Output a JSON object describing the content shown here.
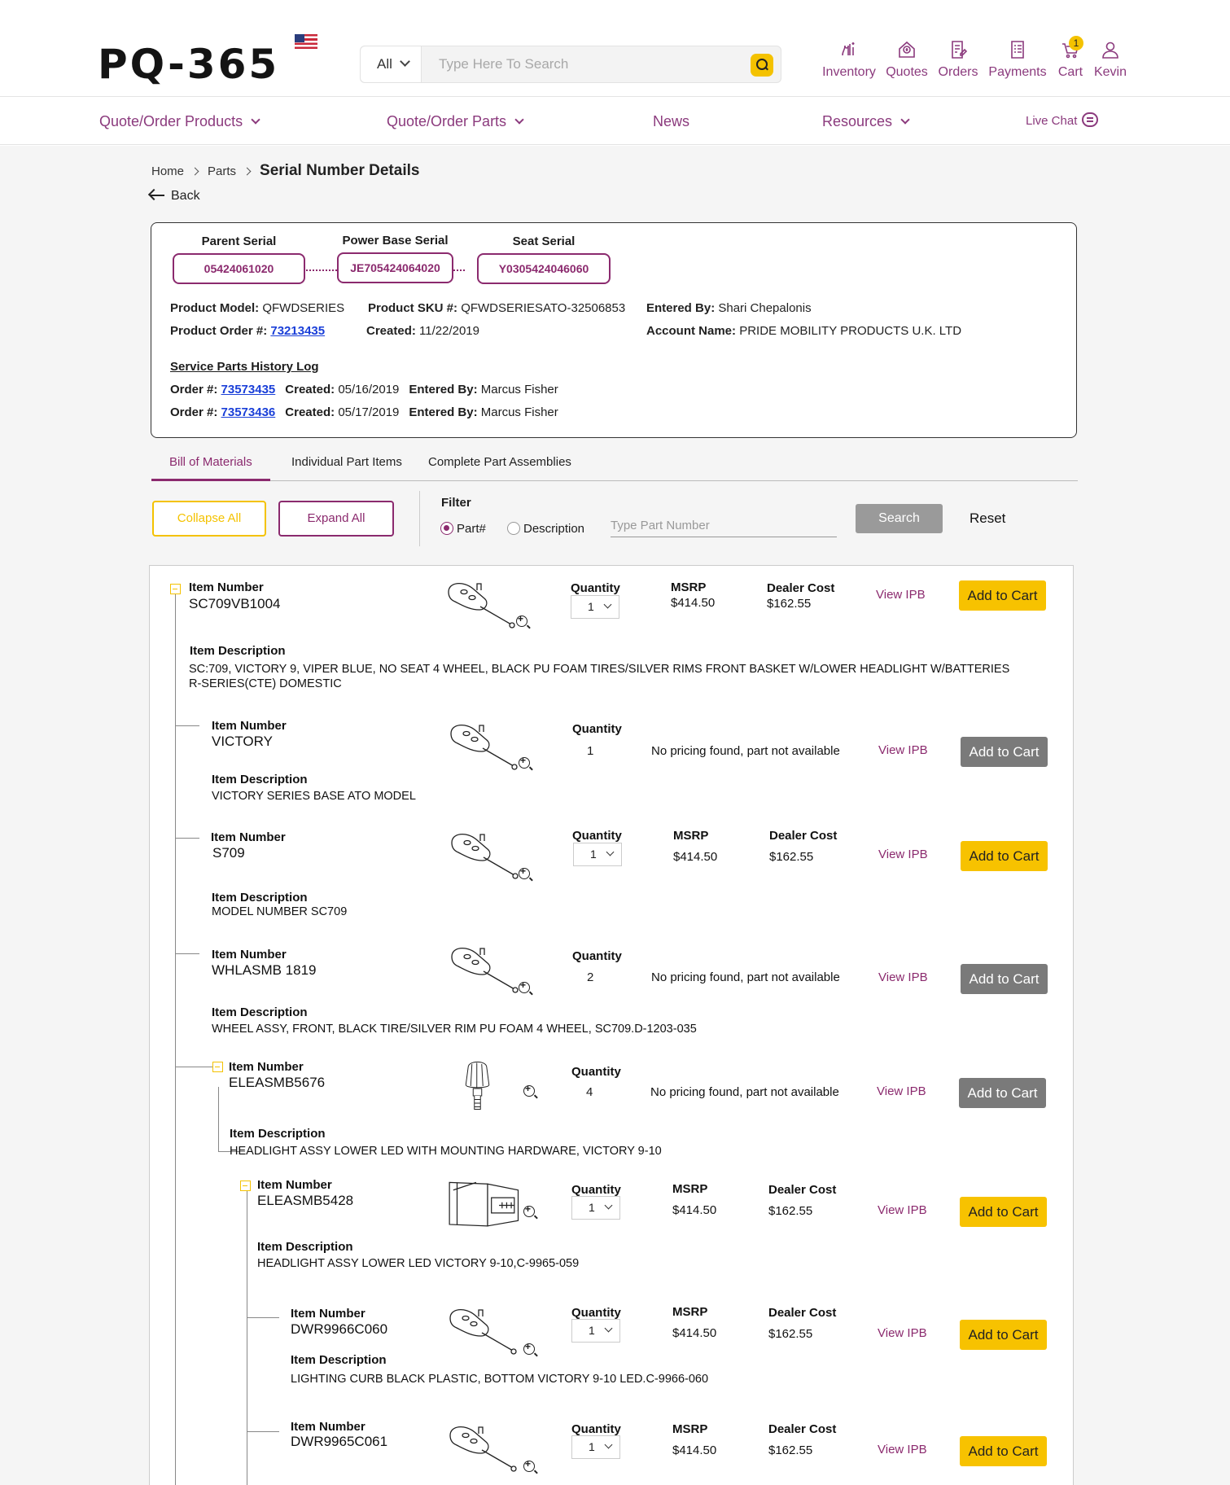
{
  "header": {
    "logo": "PQ-365",
    "search": {
      "category": "All",
      "placeholder": "Type Here To Search"
    },
    "nav": [
      {
        "label": "Inventory",
        "icon": "inventory-icon"
      },
      {
        "label": "Quotes",
        "icon": "quotes-icon"
      },
      {
        "label": "Orders",
        "icon": "orders-icon"
      },
      {
        "label": "Payments",
        "icon": "payments-icon"
      },
      {
        "label": "Cart",
        "icon": "cart-icon",
        "badge": "1"
      },
      {
        "label": "Kevin",
        "icon": "user-icon"
      }
    ]
  },
  "mainnav": {
    "items": [
      "Quote/Order Products",
      "Quote/Order Parts",
      "News",
      "Resources"
    ],
    "live_chat": "Live Chat"
  },
  "breadcrumb": {
    "home": "Home",
    "parts": "Parts",
    "current": "Serial Number Details"
  },
  "back": "Back",
  "serials": {
    "parent_label": "Parent Serial",
    "parent_value": "05424061020",
    "power_label": "Power Base Serial",
    "power_value": "JE705424064020",
    "seat_label": "Seat Serial",
    "seat_value": "Y0305424046060"
  },
  "details": {
    "model_label": "Product Model:",
    "model_value": "QFWDSERIES",
    "order_label": "Product Order #:",
    "order_value": "73213435",
    "sku_label": "Product SKU #:",
    "sku_value": "QFWDSERIESATO-32506853",
    "created_label": "Created:",
    "created_value": "11/22/2019",
    "entered_label": "Entered By:",
    "entered_value": "Shari Chepalonis",
    "account_label": "Account Name:",
    "account_value": "PRIDE MOBILITY PRODUCTS U.K. LTD"
  },
  "history": {
    "title": "Service Parts History Log",
    "order_label": "Order #:",
    "created_label": "Created:",
    "entered_label": "Entered By:",
    "rows": [
      {
        "order": "73573435",
        "created": "05/16/2019",
        "entered": "Marcus Fisher"
      },
      {
        "order": "73573436",
        "created": "05/17/2019",
        "entered": "Marcus Fisher"
      }
    ]
  },
  "tabs": [
    "Bill of Materials",
    "Individual Part Items",
    "Complete Part Assemblies"
  ],
  "controls": {
    "collapse": "Collapse All",
    "expand": "Expand All",
    "filter": "Filter",
    "radio_part": "Part#",
    "radio_desc": "Description",
    "input_placeholder": "Type Part Number",
    "search": "Search",
    "reset": "Reset"
  },
  "labels": {
    "item_number": "Item Number",
    "item_description": "Item Description",
    "quantity": "Quantity",
    "msrp": "MSRP",
    "dealer_cost": "Dealer Cost",
    "view_ipb": "View IPB",
    "add_to_cart": "Add to Cart",
    "no_pricing": "No pricing found, part not available"
  },
  "items": [
    {
      "number": "SC709VB1004",
      "desc": "SC:709, VICTORY 9, VIPER BLUE, NO SEAT 4 WHEEL, BLACK PU FOAM TIRES/SILVER RIMS FRONT BASKET W/LOWER HEADLIGHT W/BATTERIES R-SERIES(CTE) DOMESTIC",
      "qty": "1",
      "msrp": "$414.50",
      "dealer": "$162.55",
      "available": true
    },
    {
      "number": "VICTORY",
      "desc": "VICTORY SERIES BASE ATO MODEL",
      "qty": "1",
      "available": false
    },
    {
      "number": "S709",
      "desc": "MODEL NUMBER SC709",
      "qty": "1",
      "msrp": "$414.50",
      "dealer": "$162.55",
      "available": true
    },
    {
      "number": "WHLASMB 1819",
      "desc": "WHEEL ASSY, FRONT, BLACK TIRE/SILVER RIM PU FOAM 4 WHEEL, SC709.D-1203-035",
      "qty": "2",
      "available": false
    },
    {
      "number": "ELEASMB5676",
      "desc": "HEADLIGHT ASSY LOWER LED WITH MOUNTING HARDWARE, VICTORY 9-10",
      "qty": "4",
      "available": false
    },
    {
      "number": "ELEASMB5428",
      "desc": "HEADLIGHT ASSY LOWER LED VICTORY 9-10,C-9965-059",
      "qty": "1",
      "msrp": "$414.50",
      "dealer": "$162.55",
      "available": true
    },
    {
      "number": "DWR9966C060",
      "desc": "LIGHTING CURB BLACK PLASTIC, BOTTOM VICTORY 9-10 LED.C-9966-060",
      "qty": "1",
      "msrp": "$414.50",
      "dealer": "$162.55",
      "available": true
    },
    {
      "number": "DWR9965C061",
      "desc": "",
      "qty": "1",
      "msrp": "$414.50",
      "dealer": "$162.55",
      "available": true
    }
  ]
}
